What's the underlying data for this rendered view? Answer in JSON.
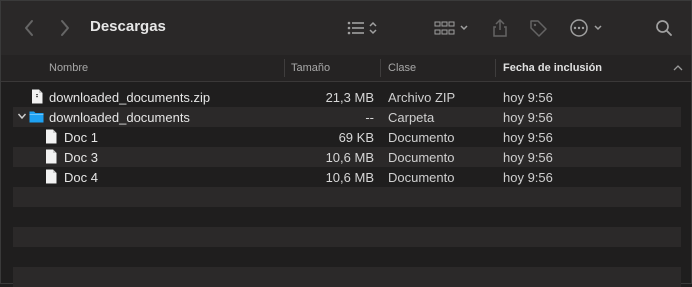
{
  "window": {
    "title": "Descargas"
  },
  "toolbar": {
    "back_icon": "chevron-left-icon",
    "forward_icon": "chevron-right-icon",
    "list_view_icon": "list-view-icon",
    "grid_view_icon": "grid-view-icon",
    "share_icon": "share-icon",
    "tag_icon": "tag-icon",
    "more_icon": "ellipsis-circle-icon",
    "search_icon": "search-icon"
  },
  "columns": {
    "name": "Nombre",
    "size": "Tamaño",
    "kind": "Clase",
    "date": "Fecha de inclusión"
  },
  "rows": [
    {
      "name": "downloaded_documents.zip",
      "size": "21,3 MB",
      "kind": "Archivo ZIP",
      "date": "hoy 9:56"
    },
    {
      "name": "downloaded_documents",
      "size": "--",
      "kind": "Carpeta",
      "date": "hoy 9:56"
    },
    {
      "name": "Doc 1",
      "size": "69 KB",
      "kind": "Documento",
      "date": "hoy 9:56"
    },
    {
      "name": "Doc 3",
      "size": "10,6 MB",
      "kind": "Documento",
      "date": "hoy 9:56"
    },
    {
      "name": "Doc 4",
      "size": "10,6 MB",
      "kind": "Documento",
      "date": "hoy 9:56"
    }
  ],
  "colors": {
    "folder": "#1ea1f2",
    "window_bg": "#1f1e1e",
    "stripe": "#2b2929"
  }
}
